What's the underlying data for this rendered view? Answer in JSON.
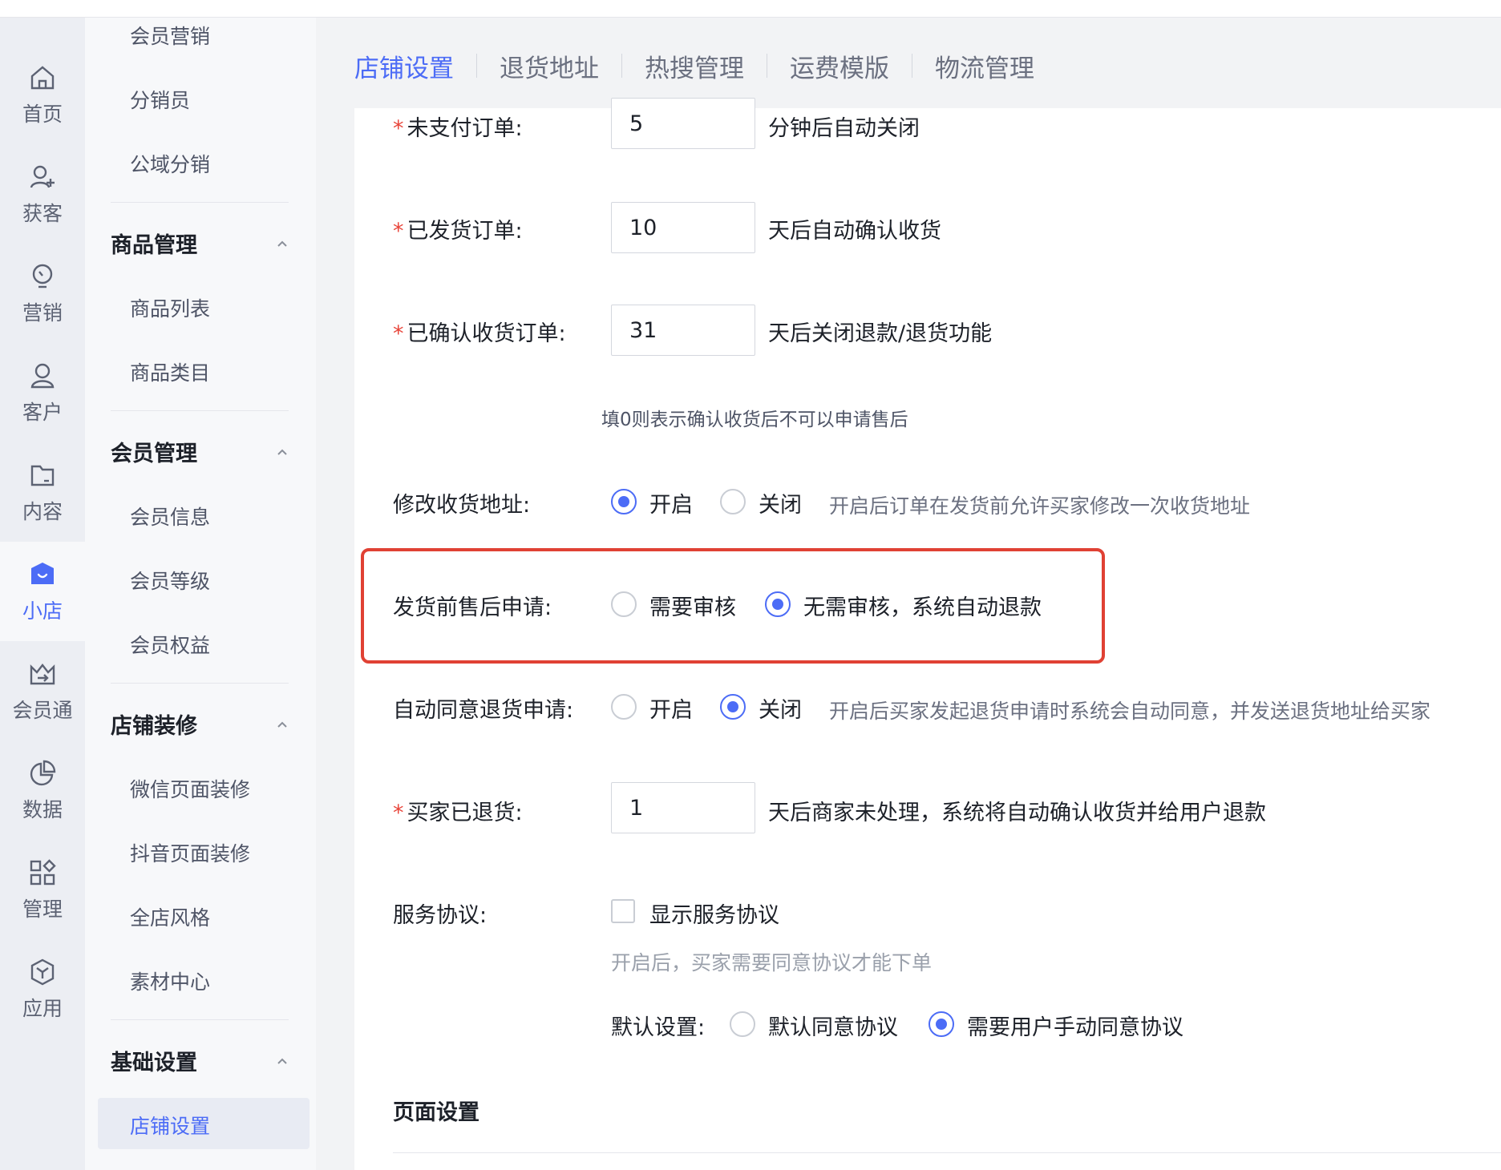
{
  "rail": [
    {
      "label": "首页",
      "icon": "home-icon"
    },
    {
      "label": "获客",
      "icon": "user-add-icon"
    },
    {
      "label": "营销",
      "icon": "bulb-icon"
    },
    {
      "label": "客户",
      "icon": "user-icon"
    },
    {
      "label": "内容",
      "icon": "folder-icon"
    },
    {
      "label": "小店",
      "icon": "shop-icon"
    },
    {
      "label": "会员通",
      "icon": "crown-icon"
    },
    {
      "label": "数据",
      "icon": "pie-chart-icon"
    },
    {
      "label": "管理",
      "icon": "apps-icon"
    },
    {
      "label": "应用",
      "icon": "cube-icon"
    }
  ],
  "menu": {
    "top_items": [
      "会员营销",
      "分销员",
      "公域分销"
    ],
    "groups": [
      {
        "title": "商品管理",
        "items": [
          "商品列表",
          "商品类目"
        ]
      },
      {
        "title": "会员管理",
        "items": [
          "会员信息",
          "会员等级",
          "会员权益"
        ]
      },
      {
        "title": "店铺装修",
        "items": [
          "微信页面装修",
          "抖音页面装修",
          "全店风格",
          "素材中心"
        ]
      },
      {
        "title": "基础设置",
        "items": [
          "店铺设置"
        ]
      }
    ]
  },
  "tabs": [
    "店铺设置",
    "退货地址",
    "热搜管理",
    "运费模版",
    "物流管理"
  ],
  "form": {
    "unpaid": {
      "label": "未支付订单:",
      "value": "5",
      "after": "分钟后自动关闭"
    },
    "shipped": {
      "label": "已发货订单:",
      "value": "10",
      "after": "天后自动确认收货"
    },
    "confirmed": {
      "label": "已确认收货订单:",
      "value": "31",
      "after": "天后关闭退款/退货功能",
      "hint": "填0则表示确认收货后不可以申请售后"
    },
    "modify_address": {
      "label": "修改收货地址:",
      "opt1": "开启",
      "opt2": "关闭",
      "hint": "开启后订单在发货前允许买家修改一次收货地址",
      "selected": "开启"
    },
    "pre_ship_after_sale": {
      "label": "发货前售后申请:",
      "opt1": "需要审核",
      "opt2": "无需审核，系统自动退款",
      "selected": "无需审核，系统自动退款"
    },
    "auto_agree_return": {
      "label": "自动同意退货申请:",
      "opt1": "开启",
      "opt2": "关闭",
      "hint": "开启后买家发起退货申请时系统会自动同意，并发送退货地址给买家",
      "selected": "关闭"
    },
    "buyer_returned": {
      "label": "买家已退货:",
      "value": "1",
      "after": "天后商家未处理，系统将自动确认收货并给用户退款"
    },
    "service_agreement": {
      "label": "服务协议:",
      "checkbox": "显示服务协议",
      "checked": false,
      "hint": "开启后，买家需要同意协议才能下单",
      "default_label": "默认设置:",
      "opt1": "默认同意协议",
      "opt2": "需要用户手动同意协议",
      "selected": "需要用户手动同意协议"
    }
  },
  "section": {
    "title": "页面设置"
  },
  "colors": {
    "accent": "#4c6cf6",
    "required": "#e8463b",
    "highlight": "#e04134"
  }
}
